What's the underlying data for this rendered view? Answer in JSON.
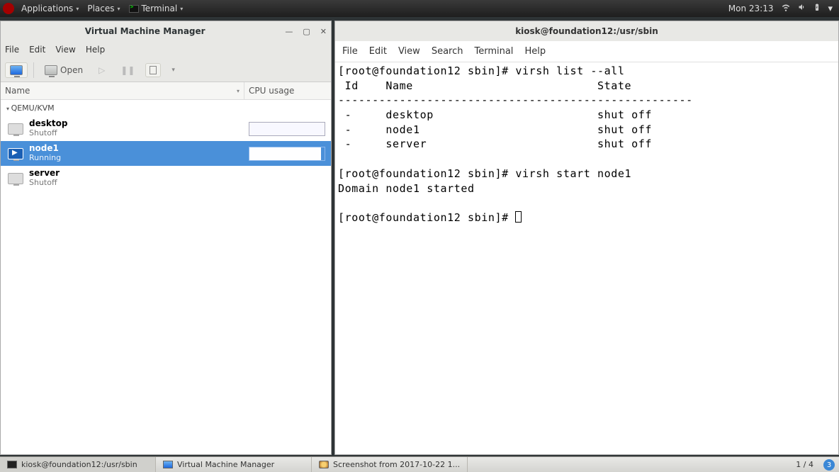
{
  "top_panel": {
    "applications": "Applications",
    "places": "Places",
    "terminal": "Terminal",
    "clock": "Mon 23:13"
  },
  "vmm": {
    "window_title": "Virtual Machine Manager",
    "menu": {
      "file": "File",
      "edit": "Edit",
      "view": "View",
      "help": "Help"
    },
    "toolbar": {
      "open": "Open"
    },
    "columns": {
      "name": "Name",
      "cpu": "CPU usage"
    },
    "connection": "QEMU/KVM",
    "vms": [
      {
        "name": "desktop",
        "state": "Shutoff",
        "selected": false,
        "has_graph": true
      },
      {
        "name": "node1",
        "state": "Running",
        "selected": true,
        "has_graph": true
      },
      {
        "name": "server",
        "state": "Shutoff",
        "selected": false,
        "has_graph": false
      }
    ]
  },
  "terminal": {
    "window_title": "kiosk@foundation12:/usr/sbin",
    "menu": {
      "file": "File",
      "edit": "Edit",
      "view": "View",
      "search": "Search",
      "terminal": "Terminal",
      "help": "Help"
    },
    "lines": [
      "[root@foundation12 sbin]# virsh list --all",
      " Id    Name                           State",
      "----------------------------------------------------",
      " -     desktop                        shut off",
      " -     node1                          shut off",
      " -     server                         shut off",
      "",
      "[root@foundation12 sbin]# virsh start node1",
      "Domain node1 started",
      "",
      "[root@foundation12 sbin]# "
    ]
  },
  "taskbar": {
    "items": [
      {
        "label": "kiosk@foundation12:/usr/sbin",
        "icon": "term",
        "active": true
      },
      {
        "label": "Virtual Machine Manager",
        "icon": "vmm",
        "active": false
      },
      {
        "label": "Screenshot from 2017-10-22 1...",
        "icon": "img",
        "active": false
      }
    ],
    "pager": "1 / 4",
    "notif_count": "3"
  }
}
